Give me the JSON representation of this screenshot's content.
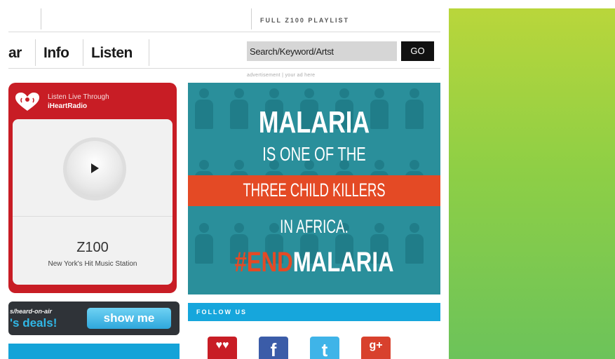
{
  "header": {
    "playlist_link": "FULL Z100 PLAYLIST"
  },
  "nav": {
    "tabs": [
      "ar",
      "Info",
      "Listen"
    ],
    "search": {
      "value": "Search/Keyword/Artst",
      "placeholder": "Search/Keyword/Artst"
    },
    "go_label": "GO"
  },
  "ad_label": "advertisement | your ad here",
  "iheart": {
    "line1": "Listen Live Through",
    "line2": "iHeartRadio",
    "station": "Z100",
    "tagline": "New York's Hit Music Station",
    "brand_color": "#c81d25"
  },
  "deals": {
    "small": "s/heard-on-air",
    "big": "'s deals!",
    "button": "show me"
  },
  "malaria_ad": {
    "title": "MALARIA",
    "line2": "IS ONE OF THE",
    "line3": "THREE CHILD KILLERS",
    "line4": "IN AFRICA.",
    "hashtag_part1": "#END",
    "hashtag_part2": "MALARIA",
    "bg_color": "#2a8f9b",
    "accent_color": "#e44a25"
  },
  "follow": {
    "label": "FOLLOW US",
    "icons": [
      {
        "name": "iheart-icon",
        "glyph": "♥♥",
        "color": "#c81d25"
      },
      {
        "name": "facebook-icon",
        "glyph": "f",
        "color": "#3b5ca8"
      },
      {
        "name": "twitter-icon",
        "glyph": "t",
        "color": "#3fb4e8"
      },
      {
        "name": "google-plus-icon",
        "glyph": "g+",
        "color": "#d8412d"
      }
    ]
  }
}
